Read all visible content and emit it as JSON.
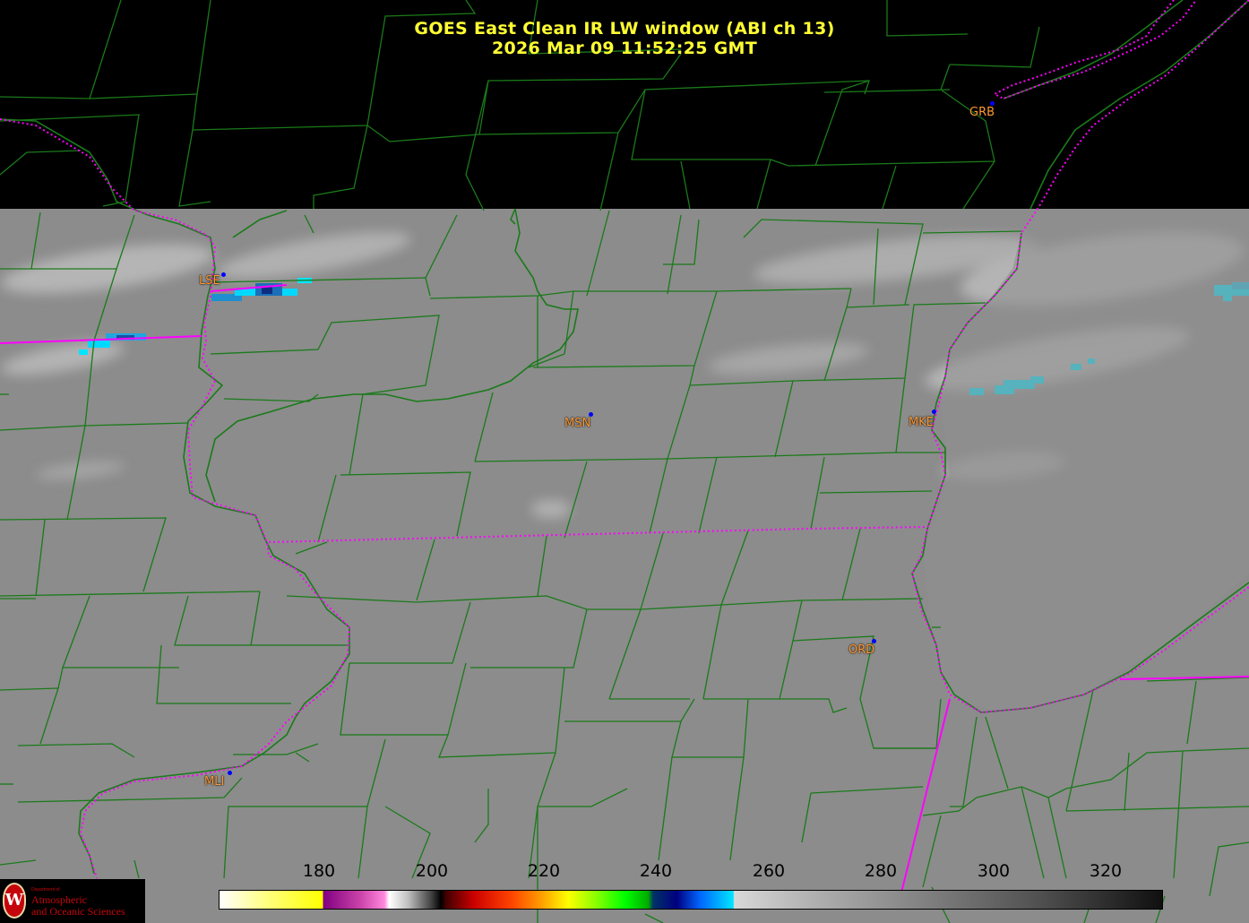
{
  "title": {
    "line1": "GOES East Clean IR LW window (ABI ch 13)",
    "line2": "2026 Mar 09  11:52:25 GMT"
  },
  "cities": [
    {
      "label": "GRB"
    },
    {
      "label": "LSE"
    },
    {
      "label": "MSN"
    },
    {
      "label": "MKE"
    },
    {
      "label": "ORD"
    },
    {
      "label": "MLI"
    }
  ],
  "colorbar": {
    "ticks": [
      "180",
      "200",
      "220",
      "240",
      "260",
      "280",
      "300",
      "320"
    ]
  },
  "logo": {
    "seal_letter": "W",
    "dept": "Department of",
    "line1": "Atmospheric",
    "line2": "and Oceanic Sciences"
  },
  "colors": {
    "title": "#ffff33",
    "county_lines": "#1a7a1a",
    "state_lines": "#ff00ff",
    "city_label": "#ff9933",
    "city_dot": "#0000ff",
    "cloud_cold": "#00e5ff",
    "uw_red": "#c5050c"
  }
}
